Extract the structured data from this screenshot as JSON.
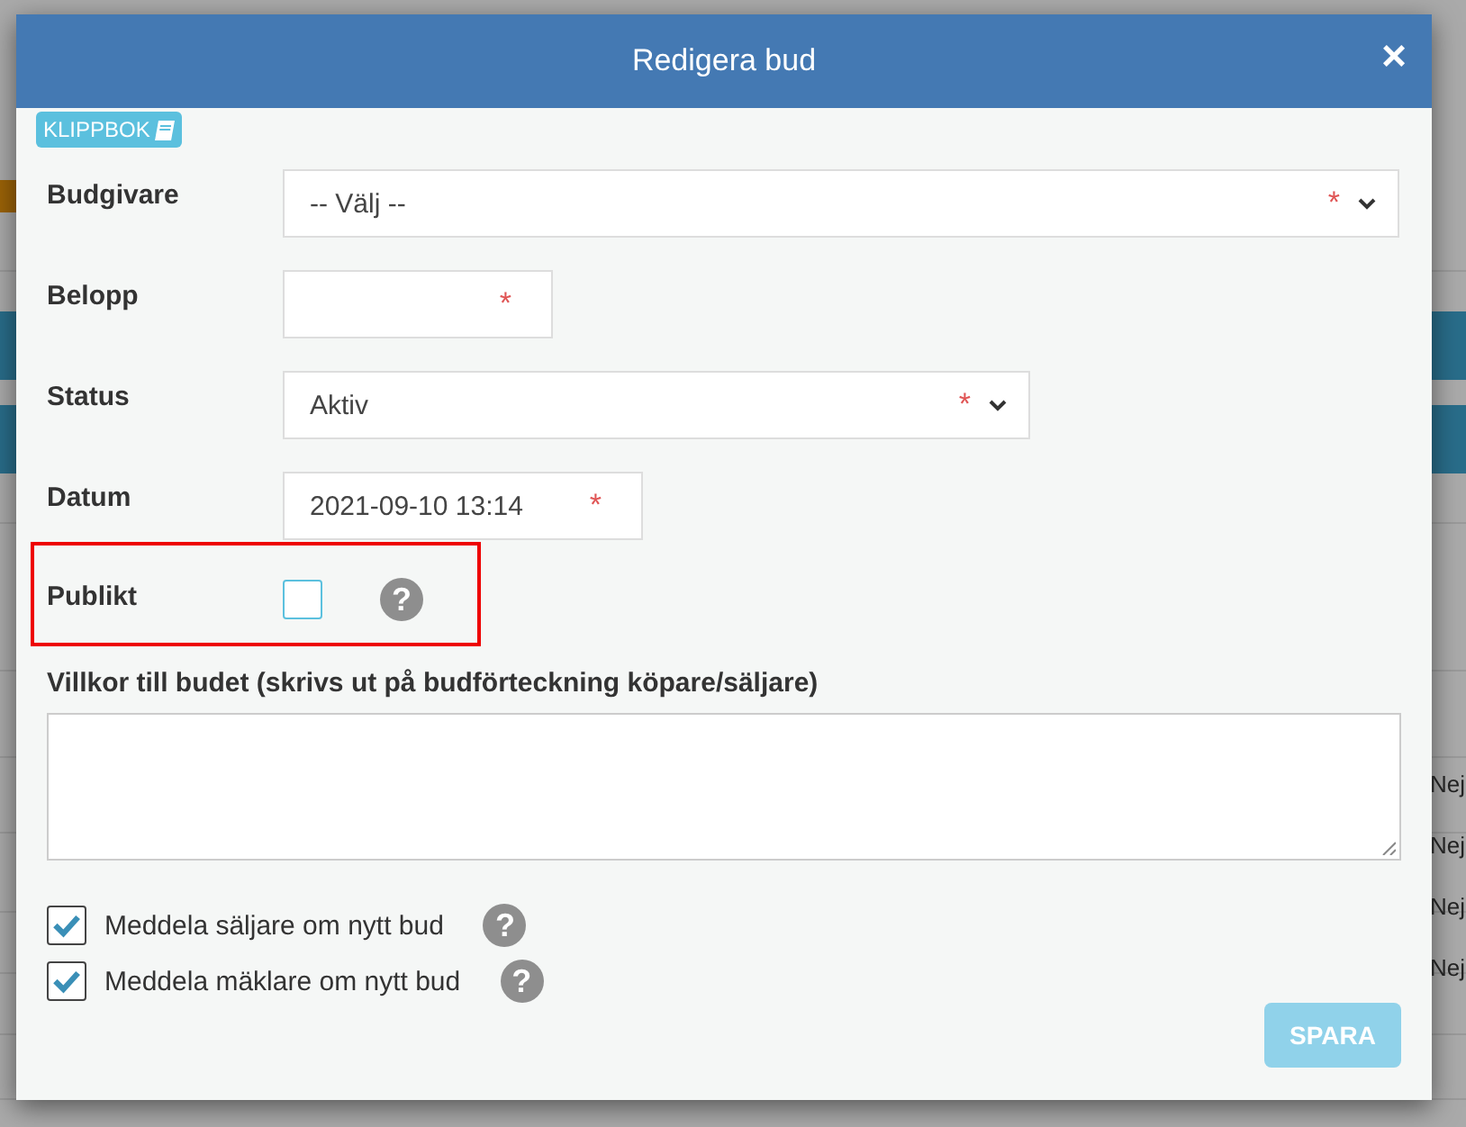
{
  "background": {
    "right_cells": [
      "Nej",
      "Nej",
      "Nej",
      "Nej"
    ]
  },
  "dialog": {
    "title": "Redigera bud",
    "close": "×",
    "clipboard_button": "KLIPPBOK",
    "required_mark": "*",
    "fields": [
      {
        "label": "Budgivare",
        "kind": "select",
        "value": "-- Välj --",
        "required": true
      },
      {
        "label": "Belopp",
        "kind": "input",
        "required": true
      },
      {
        "label": "Status",
        "kind": "select",
        "value": "Aktiv",
        "required": true
      },
      {
        "label": "Datum",
        "kind": "input",
        "value": "2021-09-10 13:14",
        "required": true
      },
      {
        "label": "Publikt",
        "kind": "checkbox",
        "checked": false,
        "highlighted": true,
        "help": "?"
      }
    ],
    "terms": {
      "label": "Villkor till budet (skrivs ut på budförteckning köpare/säljare)"
    },
    "notifications": [
      {
        "label": "Meddela säljare om nytt bud",
        "checked": true,
        "help": "?"
      },
      {
        "label": "Meddela mäklare om nytt bud",
        "checked": true,
        "help": "?"
      }
    ],
    "save_button": {
      "label": "SPARA",
      "disabled": true
    }
  }
}
